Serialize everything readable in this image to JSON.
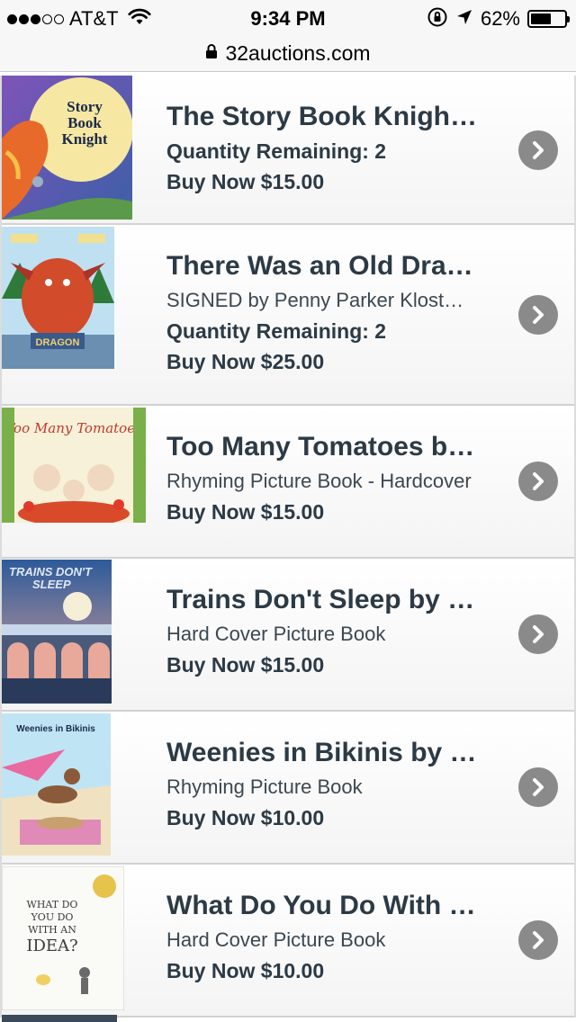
{
  "status_bar": {
    "carrier": "AT&T",
    "time": "9:34 PM",
    "battery_percent": "62%",
    "battery_level": 0.62,
    "signal_bars": 3
  },
  "url_bar": {
    "url": "32auctions.com",
    "lock_icon": "lock-icon"
  },
  "items": [
    {
      "title": "The Story Book Knigh…",
      "subtitle": "",
      "quantity": "Quantity Remaining: 2",
      "price": "Buy Now $15.00",
      "cover_text": "Story Book Knight"
    },
    {
      "title": "There Was an Old Dra…",
      "subtitle": "SIGNED by Penny Parker Klost…",
      "quantity": "Quantity Remaining: 2",
      "price": "Buy Now $25.00",
      "cover_text": "DRAGON"
    },
    {
      "title": "Too Many Tomatoes b…",
      "subtitle": "Rhyming Picture Book - Hardcover",
      "quantity": "",
      "price": "Buy Now $15.00",
      "cover_text": "Too Many Tomatoes"
    },
    {
      "title": "Trains Don't Sleep by …",
      "subtitle": "Hard Cover Picture Book",
      "quantity": "",
      "price": "Buy Now $15.00",
      "cover_text": "TRAINS DON'T SLEEP"
    },
    {
      "title": "Weenies in Bikinis by …",
      "subtitle": "Rhyming Picture Book",
      "quantity": "",
      "price": "Buy Now $10.00",
      "cover_text": "Weenies in Bikinis"
    },
    {
      "title": "What Do You Do With …",
      "subtitle": "Hard Cover Picture Book",
      "quantity": "",
      "price": "Buy Now $10.00",
      "cover_text": "WHAT DO YOU DO WITH AN IDEA?"
    }
  ]
}
